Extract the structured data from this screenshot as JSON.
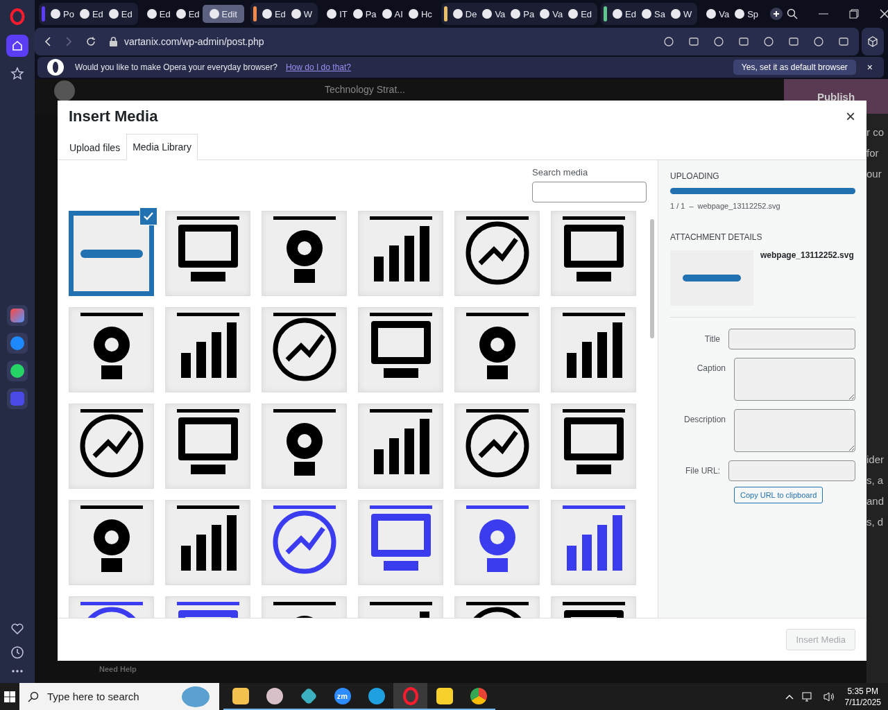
{
  "browser": {
    "tab_groups": [
      {
        "color": "#5b3df5",
        "tabs": [
          {
            "label": "Po",
            "selected": false
          },
          {
            "label": "Ed",
            "selected": false
          },
          {
            "label": "Ed",
            "selected": false
          }
        ]
      },
      {
        "tabs": [
          {
            "label": "Ed",
            "selected": false
          },
          {
            "label": "Ed",
            "selected": false
          },
          {
            "label": "Edit",
            "selected": true
          }
        ]
      },
      {
        "color": "#f08a4b",
        "tabs": [
          {
            "label": "Ed",
            "selected": false
          },
          {
            "label": "W",
            "selected": false
          }
        ]
      },
      {
        "tabs": [
          {
            "label": "IT",
            "selected": false
          },
          {
            "label": "Pa",
            "selected": false
          },
          {
            "label": "AI",
            "selected": false
          },
          {
            "label": "Hc",
            "selected": false
          }
        ]
      },
      {
        "color": "#e8c06a",
        "tabs": [
          {
            "label": "De",
            "selected": false
          },
          {
            "label": "Va",
            "selected": false
          },
          {
            "label": "Pa",
            "selected": false
          },
          {
            "label": "Va",
            "selected": false
          },
          {
            "label": "Ed",
            "selected": false
          }
        ]
      },
      {
        "color": "#5fc58e",
        "tabs": [
          {
            "label": "Ed",
            "selected": false
          },
          {
            "label": "Sa",
            "selected": false
          },
          {
            "label": "W",
            "selected": false
          }
        ]
      },
      {
        "tabs": [
          {
            "label": "Va",
            "selected": false
          },
          {
            "label": "Sp",
            "selected": false
          }
        ]
      }
    ],
    "url": "vartanix.com/wp-admin/post.php",
    "notification": {
      "message": "Would you like to make Opera your everyday browser?",
      "link": "How do I do that?",
      "button": "Yes, set it as default browser",
      "close": "×"
    }
  },
  "editor": {
    "document": "Technology Strat...",
    "publish": "Publish",
    "help": "Need Help",
    "right_fragments": [
      "r co",
      "for",
      "our",
      "ider",
      "s, a",
      "and",
      "s, d"
    ]
  },
  "modal": {
    "title": "Insert Media",
    "close": "×",
    "tabs": [
      {
        "label": "Upload files",
        "selected": false
      },
      {
        "label": "Media Library",
        "selected": true
      }
    ],
    "search": {
      "label": "Search media"
    },
    "tiles": [
      {
        "kind": "bar",
        "color": "#2271b1",
        "selected": true
      },
      {
        "kind": "icon",
        "color": "#000000",
        "selected": false
      },
      {
        "kind": "icon",
        "color": "#000000",
        "selected": false
      },
      {
        "kind": "icon",
        "color": "#000000",
        "selected": false
      },
      {
        "kind": "icon",
        "color": "#000000",
        "selected": false
      },
      {
        "kind": "icon",
        "color": "#000000",
        "selected": false
      },
      {
        "kind": "icon",
        "color": "#000000",
        "selected": false
      },
      {
        "kind": "icon",
        "color": "#000000",
        "selected": false
      },
      {
        "kind": "icon",
        "color": "#000000",
        "selected": false
      },
      {
        "kind": "icon",
        "color": "#000000",
        "selected": false
      },
      {
        "kind": "icon",
        "color": "#000000",
        "selected": false
      },
      {
        "kind": "icon",
        "color": "#000000",
        "selected": false
      },
      {
        "kind": "icon",
        "color": "#000000",
        "selected": false
      },
      {
        "kind": "icon",
        "color": "#000000",
        "selected": false
      },
      {
        "kind": "icon",
        "color": "#000000",
        "selected": false
      },
      {
        "kind": "icon",
        "color": "#000000",
        "selected": false
      },
      {
        "kind": "icon",
        "color": "#000000",
        "selected": false
      },
      {
        "kind": "icon",
        "color": "#000000",
        "selected": false
      },
      {
        "kind": "icon",
        "color": "#000000",
        "selected": false
      },
      {
        "kind": "icon",
        "color": "#000000",
        "selected": false
      },
      {
        "kind": "icon",
        "color": "#3b3bf0",
        "selected": false
      },
      {
        "kind": "icon",
        "color": "#3b3bf0",
        "selected": false
      },
      {
        "kind": "icon",
        "color": "#3b3bf0",
        "selected": false
      },
      {
        "kind": "icon",
        "color": "#3b3bf0",
        "selected": false
      },
      {
        "kind": "icon",
        "color": "#3b3bf0",
        "selected": false
      },
      {
        "kind": "icon",
        "color": "#3b3bf0",
        "selected": false
      },
      {
        "kind": "icon",
        "color": "#000000",
        "selected": false
      },
      {
        "kind": "icon",
        "color": "#000000",
        "selected": false
      },
      {
        "kind": "icon",
        "color": "#000000",
        "selected": false
      },
      {
        "kind": "icon",
        "color": "#000000",
        "selected": false
      }
    ],
    "uploading": {
      "heading": "UPLOADING",
      "level": 1,
      "count": "1 / 1",
      "dash": "–",
      "file": "webpage_13112252.svg"
    },
    "details": {
      "heading": "ATTACHMENT DETAILS",
      "file": "webpage_13112252.svg",
      "fields": [
        {
          "label": "Title",
          "kind": "input"
        },
        {
          "label": "Caption",
          "kind": "textarea"
        },
        {
          "label": "Description",
          "kind": "textarea"
        },
        {
          "label": "File URL:",
          "kind": "input"
        }
      ],
      "copy_button": "Copy URL to clipboard"
    },
    "insert_button": {
      "label": "Insert Media",
      "disabled": true
    }
  },
  "taskbar": {
    "search_placeholder": "Type here to search",
    "apps": [
      {
        "selected": false
      },
      {
        "selected": false
      },
      {
        "selected": false
      },
      {
        "selected": false,
        "label": "zm"
      },
      {
        "selected": false
      },
      {
        "selected": true
      },
      {
        "selected": false
      },
      {
        "selected": false
      }
    ],
    "time": "5:35 PM",
    "date": "7/11/2025"
  }
}
